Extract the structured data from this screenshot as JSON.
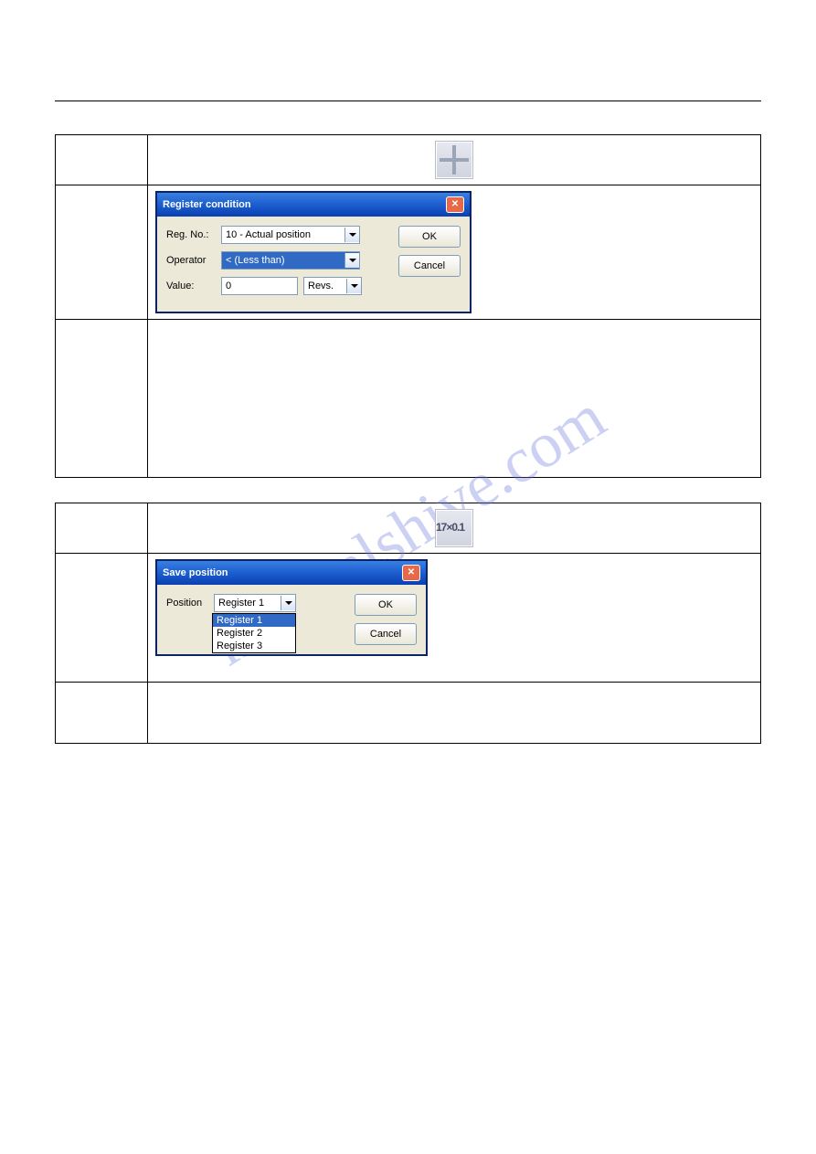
{
  "header": {
    "right": ""
  },
  "watermark": "manualshive.com",
  "sections": [
    {
      "title": "",
      "icon_name": "jump-register-icon",
      "dialog": {
        "title": "Register condition",
        "rows": [
          {
            "label": "Reg. No.:",
            "field": "select",
            "value": "10 - Actual position",
            "selected": false
          },
          {
            "label": "Operator",
            "field": "select",
            "value": "< (Less than)",
            "selected": true
          },
          {
            "label": "Value:",
            "field": "input-unit",
            "value": "0",
            "unit": "Revs."
          }
        ],
        "buttons": [
          "OK",
          "Cancel"
        ]
      }
    },
    {
      "title": "",
      "icon_name": "save-position-icon",
      "dialog": {
        "title": "Save position",
        "rows": [
          {
            "label": "Position",
            "field": "select-open",
            "value": "Register 1",
            "options": [
              "Register 1",
              "Register 2",
              "Register 3"
            ],
            "selected_index": 0
          }
        ],
        "buttons": [
          "OK",
          "Cancel"
        ]
      }
    }
  ],
  "footer": {
    "left": "",
    "page": ""
  }
}
